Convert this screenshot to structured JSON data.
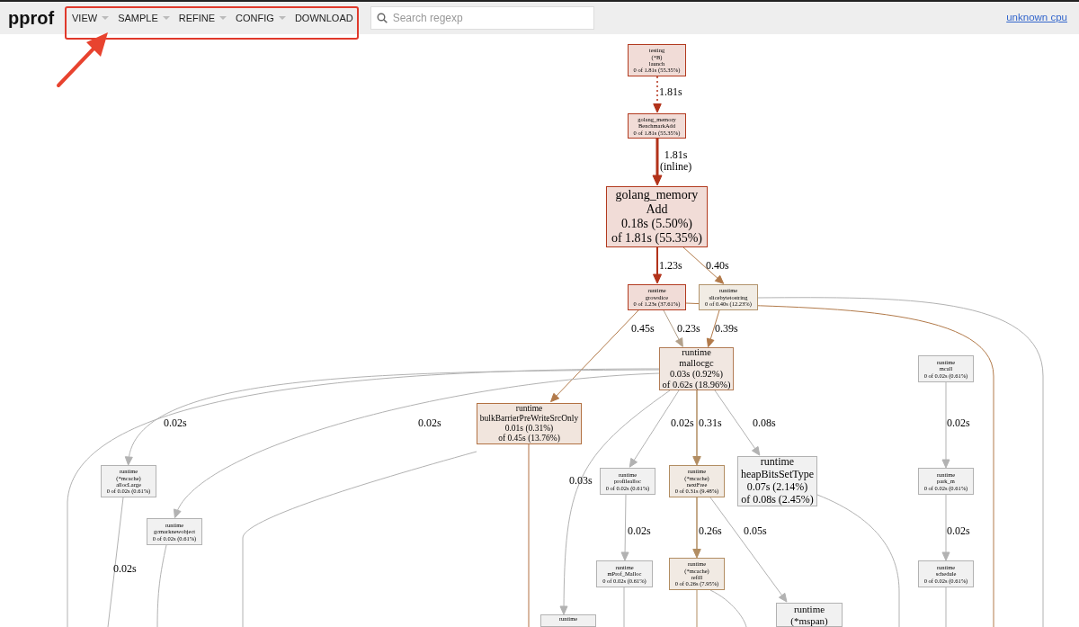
{
  "header": {
    "logo": "pprof",
    "search": {
      "placeholder": "Search regexp"
    },
    "profile_link": "unknown cpu"
  },
  "menu": [
    {
      "label": "VIEW",
      "has_menu": true
    },
    {
      "label": "SAMPLE",
      "has_menu": true
    },
    {
      "label": "REFINE",
      "has_menu": true
    },
    {
      "label": "CONFIG",
      "has_menu": true
    },
    {
      "label": "DOWNLOAD",
      "has_menu": false
    }
  ],
  "graph": {
    "nodes": [
      {
        "lines": [
          "testing",
          "(*B)",
          "launch",
          "0 of 1.81s (55.35%)"
        ],
        "color": "#b23a1f"
      },
      {
        "lines": [
          "golang_memory",
          "BenchmarkAdd",
          "0 of 1.81s (55.35%)"
        ],
        "color": "#b23a1f"
      },
      {
        "lines": [
          "golang_memory",
          "Add",
          "0.18s (5.50%)",
          "of 1.81s (55.35%)"
        ],
        "color": "#b23a1f"
      },
      {
        "lines": [
          "runtime",
          "growslice",
          "0 of 1.23s (37.61%)"
        ],
        "color": "#b23a1f"
      },
      {
        "lines": [
          "runtime",
          "slicebytetostring",
          "0 of 0.40s (12.23%)"
        ],
        "color": "#b2936b"
      },
      {
        "lines": [
          "runtime",
          "mallocgc",
          "0.03s (0.92%)",
          "of 0.62s (18.96%)"
        ],
        "color": "#b27c56"
      },
      {
        "lines": [
          "runtime",
          "bulkBarrierPreWriteSrcOnly",
          "0.01s (0.31%)",
          "of 0.45s (13.76%)"
        ],
        "color": "#b27142"
      },
      {
        "lines": [
          "runtime",
          "(*mcache)",
          "allocLarge",
          "0 of 0.02s (0.61%)"
        ],
        "color": "#b2b2b2"
      },
      {
        "lines": [
          "runtime",
          "gcmarknewobject",
          "0 of 0.02s (0.61%)"
        ],
        "color": "#b2b2b2"
      },
      {
        "lines": [
          "runtime",
          "profilealloc",
          "0 of 0.02s (0.61%)"
        ],
        "color": "#b2b2b2"
      },
      {
        "lines": [
          "runtime",
          "(*mcache)",
          "nextFree",
          "0 of 0.31s (9.48%)"
        ],
        "color": "#b28d62"
      },
      {
        "lines": [
          "runtime",
          "heapBitsSetType",
          "0.07s (2.14%)",
          "of 0.08s (2.45%)"
        ],
        "color": "#b2b2b2"
      },
      {
        "lines": [
          "runtime",
          "mcall",
          "0 of 0.02s (0.61%)"
        ],
        "color": "#b2b2b2"
      },
      {
        "lines": [
          "runtime",
          "park_m",
          "0 of 0.02s (0.61%)"
        ],
        "color": "#b2b2b2"
      },
      {
        "lines": [
          "runtime",
          "mProf_Malloc",
          "0 of 0.02s (0.61%)"
        ],
        "color": "#b2b2b2"
      },
      {
        "lines": [
          "runtime",
          "(*mcache)",
          "refill",
          "0 of 0.26s (7.95%)"
        ],
        "color": "#b28d62"
      },
      {
        "lines": [
          "runtime",
          "schedule",
          "0 of 0.02s (0.61%)"
        ],
        "color": "#b2b2b2"
      },
      {
        "lines": [
          "runtime"
        ],
        "color": "#b2b2b2"
      },
      {
        "lines": [
          "runtime",
          "(*mspan)"
        ],
        "color": "#b2b2b2"
      }
    ],
    "edges": [
      {
        "label": "1.81s",
        "dotted": true
      },
      {
        "label": "1.81s",
        "note": "(inline)",
        "dotted": false
      },
      {
        "label": "1.23s",
        "dotted": false
      },
      {
        "label": "0.40s",
        "dotted": false
      },
      {
        "label": "0.45s",
        "dotted": false
      },
      {
        "label": "0.23s",
        "dotted": false
      },
      {
        "label": "0.39s",
        "dotted": false
      },
      {
        "label": "0.02s",
        "dotted": false
      },
      {
        "label": "0.02s",
        "dotted": false
      },
      {
        "label": "0.02s",
        "dotted": false
      },
      {
        "label": "0.31s",
        "dotted": false
      },
      {
        "label": "0.08s",
        "dotted": false
      },
      {
        "label": "0.03s",
        "dotted": false
      },
      {
        "label": "0.02s",
        "dotted": false
      },
      {
        "label": "0.02s",
        "dotted": false
      },
      {
        "label": "0.26s",
        "dotted": false
      },
      {
        "label": "0.05s",
        "dotted": false
      },
      {
        "label": "0.02s",
        "dotted": false
      },
      {
        "label": "0.02s",
        "dotted": false
      }
    ]
  }
}
